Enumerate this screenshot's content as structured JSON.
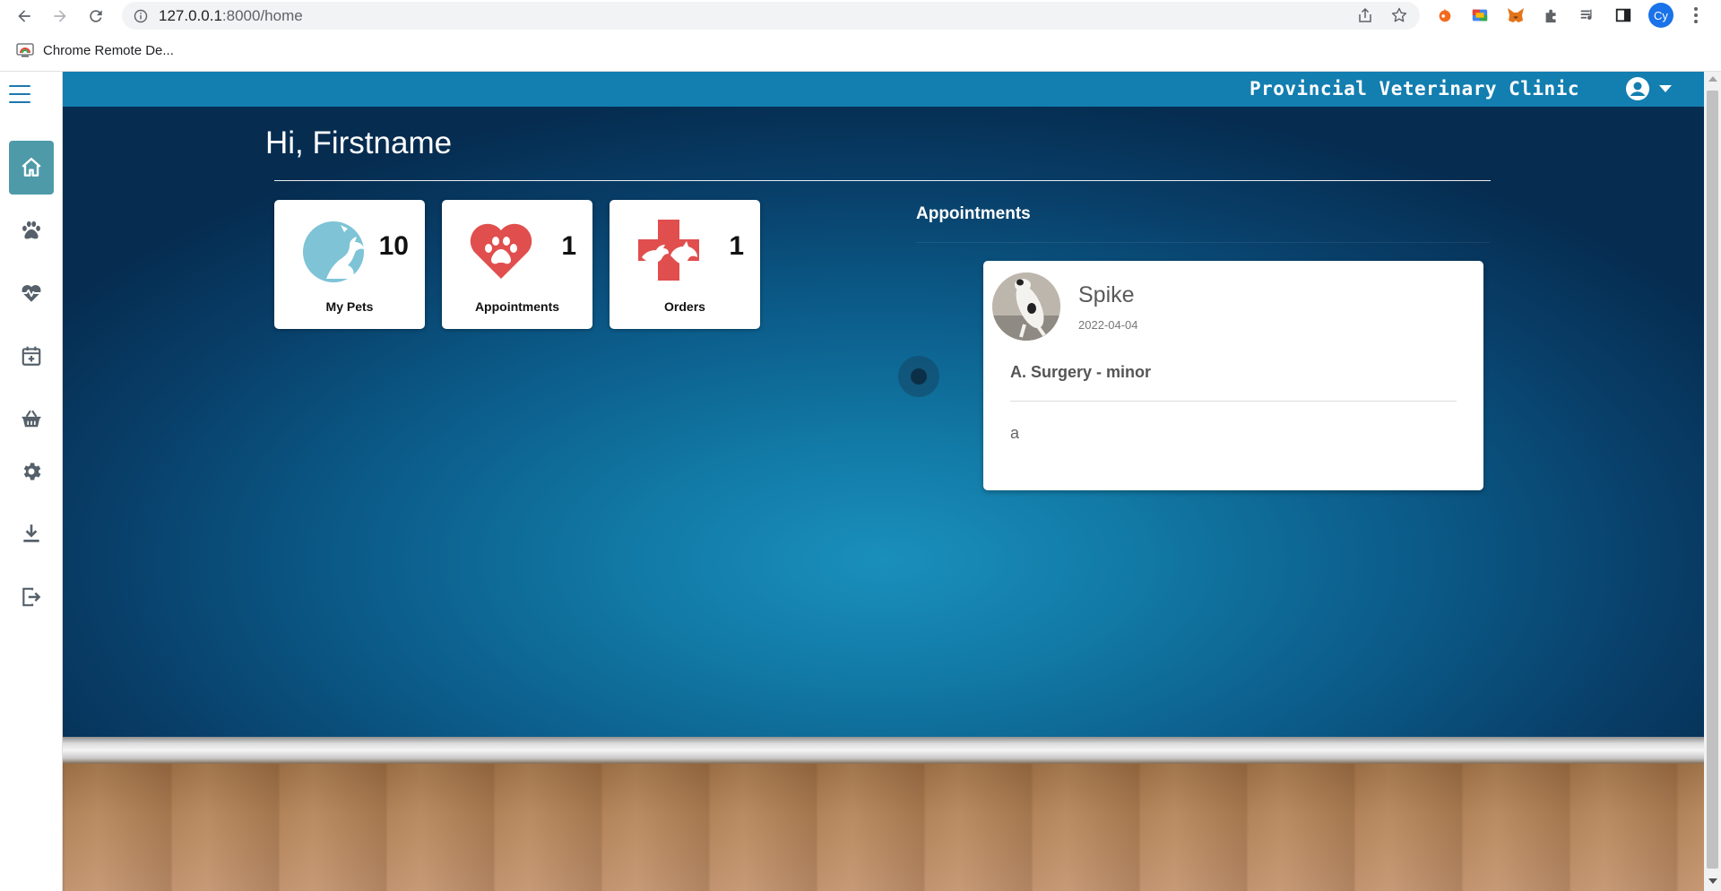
{
  "browser": {
    "url_host": "127.0.0.1",
    "url_path": ":8000/home",
    "bookmark_label": "Chrome Remote De...",
    "profile_initials": "Cy"
  },
  "header": {
    "clinic_name": "Provincial Veterinary Clinic"
  },
  "sidebar": {
    "items": [
      {
        "icon": "home-icon",
        "active": true
      },
      {
        "icon": "paw-icon",
        "active": false
      },
      {
        "icon": "heartbeat-icon",
        "active": false
      },
      {
        "icon": "calendar-plus-icon",
        "active": false
      },
      {
        "icon": "basket-icon",
        "active": false
      },
      {
        "icon": "gear-icon",
        "active": false
      },
      {
        "icon": "download-icon",
        "active": false
      },
      {
        "icon": "logout-icon",
        "active": false
      }
    ]
  },
  "main": {
    "greeting": "Hi, Firstname",
    "stats": [
      {
        "label": "My Pets",
        "count": "10",
        "icon": "pets-globe-icon"
      },
      {
        "label": "Appointments",
        "count": "1",
        "icon": "heart-paw-icon"
      },
      {
        "label": "Orders",
        "count": "1",
        "icon": "medical-cross-pets-icon"
      }
    ],
    "appointments_title": "Appointments",
    "appointment": {
      "pet_name": "Spike",
      "date": "2022-04-04",
      "type": "A. Surgery - minor",
      "note": "a"
    }
  },
  "colors": {
    "topbar": "#137eb0",
    "sidebar_active": "#4e9aa8",
    "wall_center": "#1a8fbc",
    "wall_edge": "#062c50",
    "icon_red": "#e04e4e",
    "icon_blue": "#7ec3d6"
  }
}
